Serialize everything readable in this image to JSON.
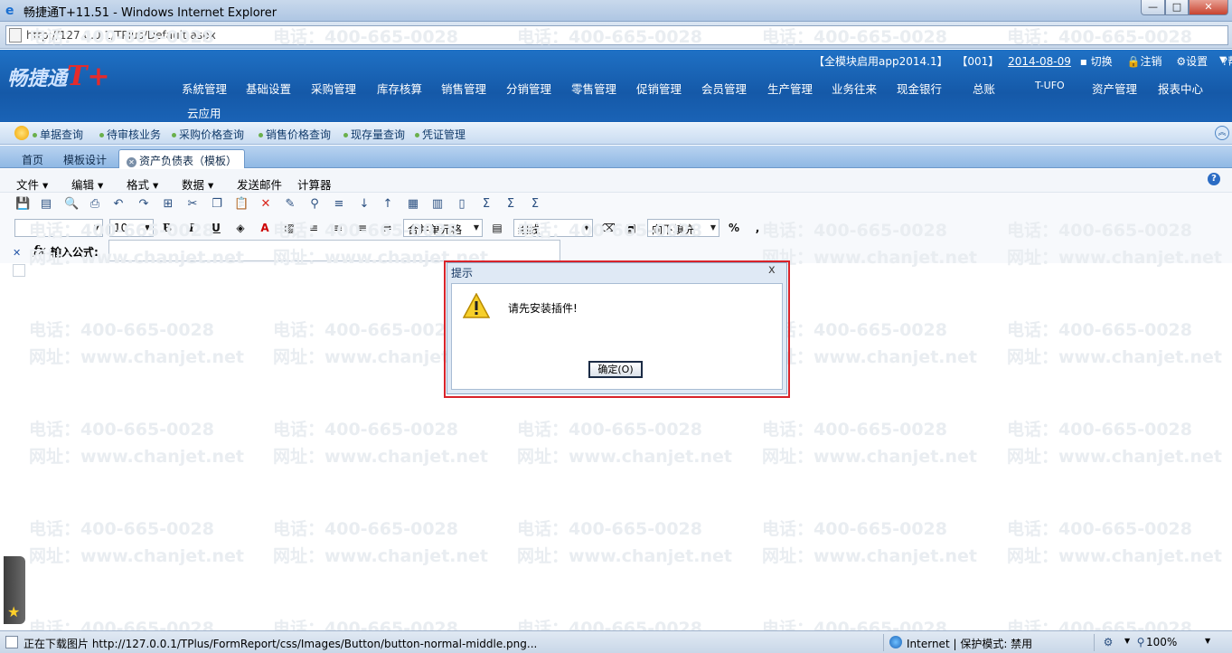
{
  "window": {
    "title": "畅捷通T+11.51 - Windows Internet Explorer",
    "minimize": "—",
    "maximize": "□",
    "close": "✕"
  },
  "address": {
    "url": "http://127.0.0.1/TPlus/Default.aspx"
  },
  "header": {
    "logo_text": "畅捷通",
    "logo_mark": "T+",
    "module_info": "【全模块启用app2014.1】",
    "account": "【001】",
    "date": "2014-08-09",
    "switch_label": "切换",
    "logout_label": "注销",
    "settings_label": "设置",
    "help_label": "帮助"
  },
  "main_menu": {
    "items": [
      "系統管理",
      "基础设置",
      "采购管理",
      "库存核算",
      "销售管理",
      "分销管理",
      "零售管理",
      "促销管理",
      "会员管理",
      "生产管理",
      "业务往来",
      "现金银行",
      "总账",
      "T-UFO",
      "资产管理",
      "报表中心"
    ],
    "second_row": "云应用"
  },
  "quick_links": [
    "单据查询",
    "待审核业务",
    "采购价格查询",
    "销售价格查询",
    "现存量查询",
    "凭证管理"
  ],
  "tabs": {
    "home": "首页",
    "template_design": "模板设计",
    "active": "资产负债表（模板）"
  },
  "menubar": {
    "file": "文件",
    "edit": "编辑",
    "format": "格式",
    "data": "数据",
    "send_mail": "发送邮件",
    "calculator": "计算器"
  },
  "format_toolbar": {
    "font_name": "",
    "font_size": "10",
    "bold": "B",
    "italic": "I",
    "underline": "U",
    "merge_cells": "合并单元格",
    "border_style": "细线",
    "fill_down": "向下填充",
    "percent": "%",
    "comma": ","
  },
  "formula": {
    "label": "输入公式:",
    "value": ""
  },
  "watermark": {
    "phone": "电话：400-665-0028",
    "site": "网址：www.chanjet.net"
  },
  "dialog": {
    "title": "提示",
    "close": "x",
    "message": "请先安装插件!",
    "ok_button": "确定(O)"
  },
  "statusbar": {
    "loading_text": "正在下载图片 http://127.0.0.1/TPlus/FormReport/css/Images/Button/button-normal-middle.png...",
    "zone_text": "Internet | 保护模式: 禁用",
    "zoom": "100%"
  }
}
